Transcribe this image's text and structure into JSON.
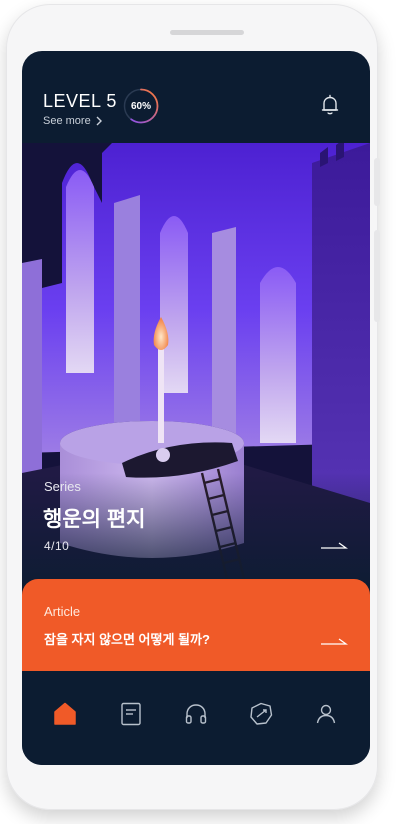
{
  "header": {
    "level_text": "LEVEL 5",
    "see_more": "See more",
    "progress_percent": 60,
    "progress_label": "60%",
    "ring_colors": [
      "#ff7a2e",
      "#7f4dff"
    ]
  },
  "featured_series": {
    "category": "Series",
    "title": "행운의 편지",
    "episode": "4/10"
  },
  "article_card": {
    "category": "Article",
    "title": "잠을 자지 않으면 어떻게 될까?",
    "background": "#f05a28"
  },
  "bottom_nav": {
    "active_color": "#f05a28",
    "inactive_color": "#b8c1cc",
    "items": [
      {
        "icon": "home-icon",
        "active": true
      },
      {
        "icon": "book-icon",
        "active": false
      },
      {
        "icon": "headphones-icon",
        "active": false
      },
      {
        "icon": "sticker-icon",
        "active": false
      },
      {
        "icon": "profile-icon",
        "active": false
      }
    ]
  },
  "colors": {
    "screen_background": "#0c1c31",
    "accent": "#f05a28"
  }
}
